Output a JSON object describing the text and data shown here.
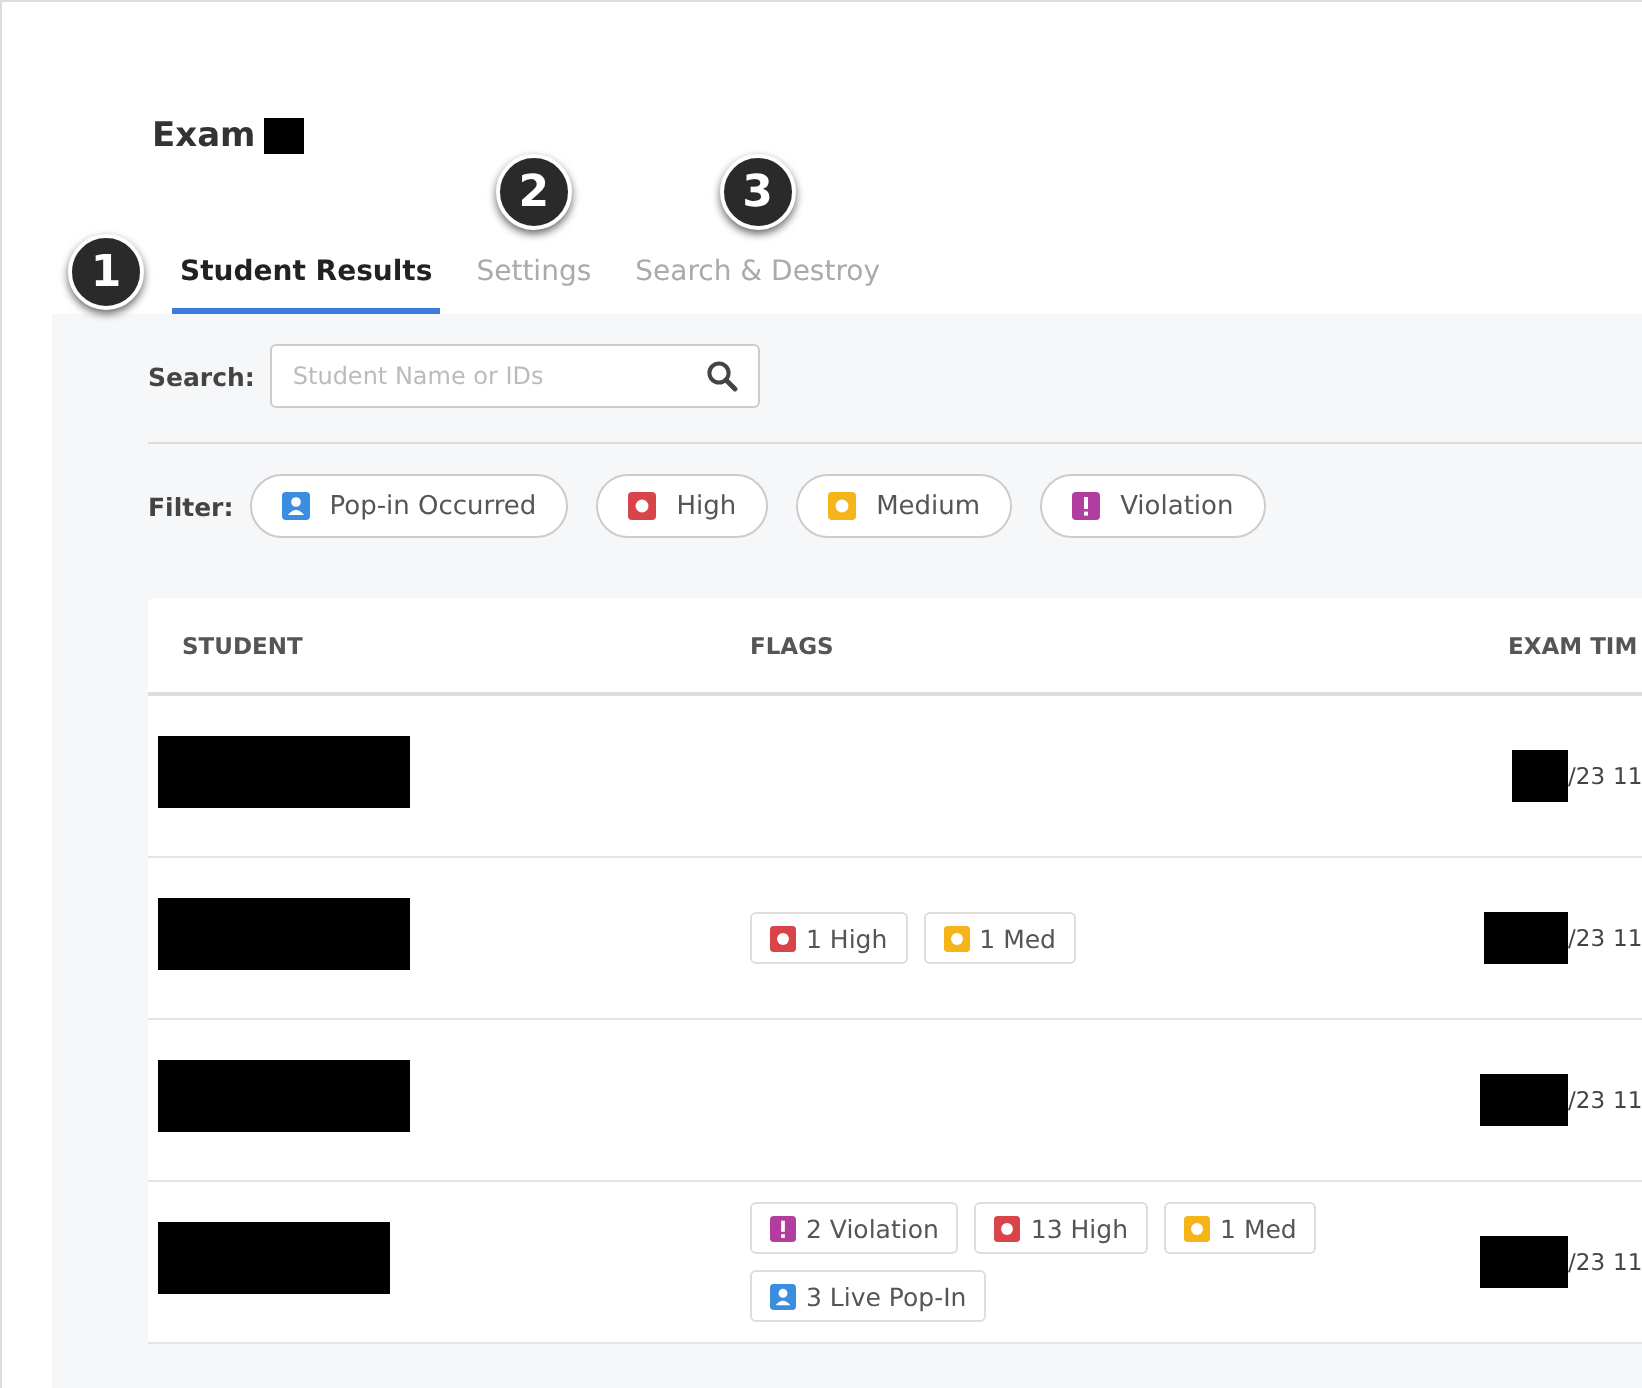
{
  "title": "Exam",
  "tabs": [
    {
      "label": "Student Results",
      "selected": true,
      "callout": "1"
    },
    {
      "label": "Settings",
      "selected": false,
      "callout": "2"
    },
    {
      "label": "Search & Destroy",
      "selected": false,
      "callout": "3"
    }
  ],
  "search": {
    "label": "Search:",
    "placeholder": "Student Name or IDs"
  },
  "filter": {
    "label": "Filter:",
    "chips": [
      {
        "kind": "popin",
        "label": "Pop-in Occurred"
      },
      {
        "kind": "high",
        "label": "High"
      },
      {
        "kind": "medium",
        "label": "Medium"
      },
      {
        "kind": "violation",
        "label": "Violation"
      }
    ]
  },
  "table": {
    "columns": [
      "STUDENT",
      "FLAGS",
      "EXAM TIM"
    ],
    "rows": [
      {
        "flags": [],
        "time": "/23",
        "time_cut": "11"
      },
      {
        "flags": [
          {
            "kind": "high",
            "label": "1 High"
          },
          {
            "kind": "medium",
            "label": "1 Med"
          }
        ],
        "time": "/23",
        "time_cut": "11"
      },
      {
        "flags": [],
        "time": "/23",
        "time_cut": "11"
      },
      {
        "flags": [
          {
            "kind": "violation",
            "label": "2 Violation"
          },
          {
            "kind": "high",
            "label": "13 High"
          },
          {
            "kind": "medium",
            "label": "1 Med"
          },
          {
            "kind": "popin",
            "label": "3 Live Pop-In"
          }
        ],
        "time": "/23",
        "time_cut": "11"
      }
    ]
  }
}
